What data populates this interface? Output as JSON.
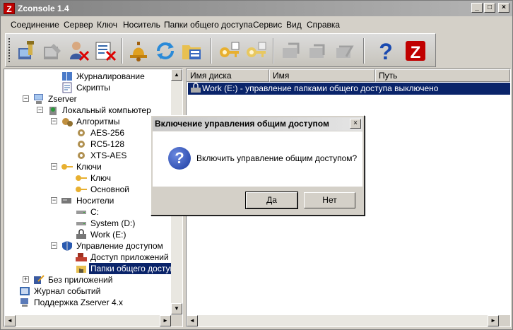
{
  "window": {
    "title": "Zconsole 1.4",
    "app_icon": "z-logo-icon",
    "controls": [
      "_",
      "□",
      "×"
    ]
  },
  "menu": [
    "Соединение",
    "Сервер",
    "Ключ",
    "Носитель",
    "Папки общего доступа",
    "Сервис",
    "Вид",
    "Справка"
  ],
  "toolbar": {
    "tools": [
      "connect-icon",
      "disconnect-icon",
      "remove-user-icon",
      "remove-user-list-icon",
      "bell-icon",
      "refresh-icon",
      "folders-icon",
      "key-add-icon",
      "key-remove-icon",
      "share-icon",
      "share-2-icon",
      "share-3-icon",
      "help-icon",
      "zserver-icon"
    ]
  },
  "tree": {
    "items": [
      {
        "label": "Журналирование",
        "icon": "log-book-icon"
      },
      {
        "label": "Скрипты",
        "icon": "script-icon"
      },
      {
        "label": "Zserver",
        "icon": "computer-icon",
        "expander": "−"
      },
      {
        "label": "Локальный компьютер",
        "icon": "local-computer-icon",
        "expander": "−"
      },
      {
        "label": "Алгоритмы",
        "icon": "gears-icon",
        "expander": "−"
      },
      {
        "label": "AES-256",
        "icon": "gear-icon"
      },
      {
        "label": "RC5-128",
        "icon": "gear-icon"
      },
      {
        "label": "XTS-AES",
        "icon": "gear-icon"
      },
      {
        "label": "Ключи",
        "icon": "key-icon",
        "expander": "−"
      },
      {
        "label": "Ключ",
        "icon": "key-icon"
      },
      {
        "label": "Основной",
        "icon": "key-icon"
      },
      {
        "label": "Носители",
        "icon": "drives-icon",
        "expander": "−"
      },
      {
        "label": "C:",
        "icon": "drive-icon"
      },
      {
        "label": "System (D:)",
        "icon": "drive-icon"
      },
      {
        "label": "Work (E:)",
        "icon": "locked-drive-icon"
      },
      {
        "label": "Управление доступом",
        "icon": "shield-icon",
        "expander": "−"
      },
      {
        "label": "Доступ приложений",
        "icon": "app-access-icon"
      },
      {
        "label": "Папки общего доступа",
        "icon": "shared-folder-icon"
      },
      {
        "label": "Без приложений",
        "icon": "no-apps-icon",
        "expander": "+"
      },
      {
        "label": "Журнал событий",
        "icon": "event-log-icon"
      },
      {
        "label": "Поддержка Zserver 4.x",
        "icon": "support-icon"
      }
    ]
  },
  "list": {
    "columns": [
      "Имя диска",
      "Имя",
      "Путь"
    ],
    "rows": [
      {
        "icon": "locked-drive-icon",
        "text": "Work (E:)  - управление папками общего доступа выключено"
      }
    ]
  },
  "dialog": {
    "title": "Включение управления общим доступом",
    "close": "×",
    "icon": "question-icon",
    "icon_glyph": "?",
    "message": "Включить управление общим доступом?",
    "yes": "Да",
    "no": "Нет"
  },
  "scroll": {
    "up": "▲",
    "down": "▼",
    "left": "◄",
    "right": "►"
  }
}
